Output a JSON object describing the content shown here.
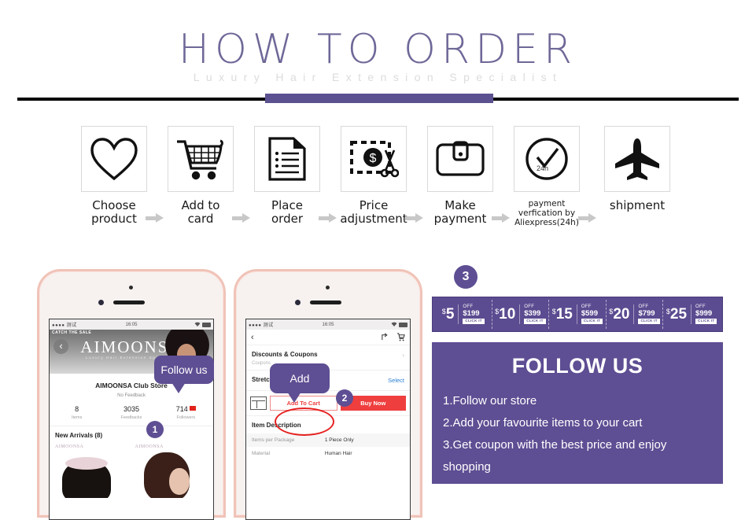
{
  "header": {
    "title": "HOW TO ORDER",
    "subtitle": "Luxury Hair Extension Specialist"
  },
  "steps": [
    {
      "icon": "heart-icon",
      "label_line1": "Choose",
      "label_line2": "product"
    },
    {
      "icon": "cart-icon",
      "label_line1": "Add to",
      "label_line2": "card"
    },
    {
      "icon": "document-icon",
      "label_line1": "Place",
      "label_line2": "order"
    },
    {
      "icon": "price-adjust-icon",
      "label_line1": "Price",
      "label_line2": "adjustment"
    },
    {
      "icon": "wallet-icon",
      "label_line1": "Make",
      "label_line2": "payment"
    },
    {
      "icon": "clock-check-icon",
      "label_line1": "payment",
      "label_line2": "verfication by",
      "label_line3": "Aliexpress(24h)",
      "inner_text": "24h"
    },
    {
      "icon": "airplane-icon",
      "label_line1": "shipment",
      "label_line2": ""
    }
  ],
  "phone1": {
    "statusbar": {
      "carrier": "●●●● 测试",
      "time": "16:05"
    },
    "sale_badge": "CATCH THE SALE",
    "back_icon": "back-chevron-icon",
    "brand": "AIMOONSA",
    "brand_sub": "Luxury Hair Extension Specialist",
    "store_name": "AIMOONSA Club Store",
    "feedback": "No Feedback",
    "stats": [
      {
        "value": "8",
        "label": "Items"
      },
      {
        "value": "3035",
        "label": "Feedbacks"
      },
      {
        "value": "714",
        "label": "Followers"
      }
    ],
    "new_arrivals": "New Arrivals (8)",
    "product_watermark": "AIMOONSA",
    "bubble": "Follow us",
    "step_badge": "1"
  },
  "phone2": {
    "statusbar": {
      "carrier": "●●●● 测试",
      "time": "16:05"
    },
    "back_icon": "back-chevron-icon",
    "share_icon": "share-icon",
    "cart_icon": "cart-icon",
    "coupons_title": "Discounts & Coupons",
    "coupons_sub": "Coupons",
    "length_title": "Stretched Length",
    "select_label": "Select",
    "add_to_cart": "Add To Cart",
    "buy_now": "Buy Now",
    "store_icon": "store-icon",
    "desc_title": "Item Description",
    "desc_rows": [
      {
        "key": "Items per Package",
        "value": "1 Piece Only"
      },
      {
        "key": "Material",
        "value": "Human Hair"
      }
    ],
    "bubble": "Add",
    "step_badge": "2"
  },
  "right": {
    "step_badge": "3",
    "coupons": [
      {
        "amount": "5",
        "currency": "$",
        "off": "OFF",
        "min": "$199",
        "click": "CLICK IT"
      },
      {
        "amount": "10",
        "currency": "$",
        "off": "OFF",
        "min": "$399",
        "click": "CLICK IT"
      },
      {
        "amount": "15",
        "currency": "$",
        "off": "OFF",
        "min": "$599",
        "click": "CLICK IT"
      },
      {
        "amount": "20",
        "currency": "$",
        "off": "OFF",
        "min": "$799",
        "click": "CLICK IT"
      },
      {
        "amount": "25",
        "currency": "$",
        "off": "OFF",
        "min": "$999",
        "click": "CLICK IT"
      }
    ],
    "follow_title": "FOLLOW US",
    "follow_items": [
      "1.Follow our store",
      "2.Add your favourite items to your cart",
      "3.Get coupon with the best price and enjoy",
      "shopping"
    ]
  },
  "colors": {
    "purple": "#5e4e93",
    "purple_dark": "#5b4b90",
    "accent_red": "#ef3e3e",
    "rose_gold": "#f0c3b8"
  }
}
